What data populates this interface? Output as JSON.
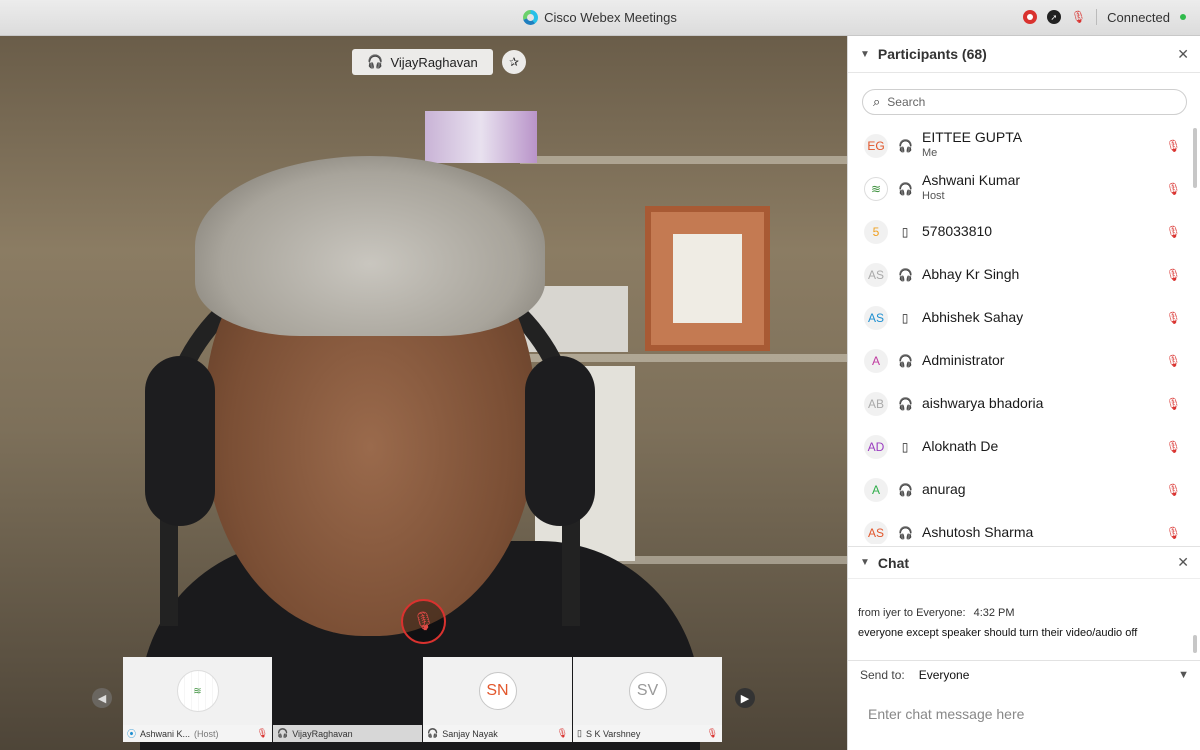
{
  "window": {
    "title": "Cisco Webex Meetings",
    "status": "Connected"
  },
  "video": {
    "active_speaker": "VijayRaghavan",
    "thumbnails": [
      {
        "name": "Ashwani K...",
        "role": "(Host)",
        "initials": ""
      },
      {
        "name": "VijayRaghavan",
        "role": "",
        "initials": ""
      },
      {
        "name": "Sanjay Nayak",
        "role": "",
        "initials": "SN"
      },
      {
        "name": "S K Varshney",
        "role": "",
        "initials": "SV"
      }
    ]
  },
  "participants": {
    "title": "Participants (68)",
    "search_placeholder": "Search",
    "items": [
      {
        "initials": "EG",
        "name": "EITTEE GUPTA",
        "sub": "Me",
        "device": "headset",
        "color": "#e2572c"
      },
      {
        "initials": "",
        "name": "Ashwani Kumar",
        "sub": "Host",
        "device": "headset",
        "color": "#3a8f3a"
      },
      {
        "initials": "5",
        "name": "578033810",
        "sub": "",
        "device": "phone",
        "color": "#f0a020"
      },
      {
        "initials": "AS",
        "name": "Abhay Kr Singh",
        "sub": "",
        "device": "headset",
        "color": "#aaaaaa"
      },
      {
        "initials": "AS",
        "name": "Abhishek Sahay",
        "sub": "",
        "device": "phone",
        "color": "#1e8fd1"
      },
      {
        "initials": "A",
        "name": "Administrator",
        "sub": "",
        "device": "headset",
        "color": "#c03aa0"
      },
      {
        "initials": "AB",
        "name": "aishwarya bhadoria",
        "sub": "",
        "device": "headset",
        "color": "#aaaaaa"
      },
      {
        "initials": "AD",
        "name": "Aloknath De",
        "sub": "",
        "device": "phone",
        "color": "#9a3cc0"
      },
      {
        "initials": "A",
        "name": "anurag",
        "sub": "",
        "device": "headset",
        "color": "#2fae4a"
      },
      {
        "initials": "AS",
        "name": "Ashutosh Sharma",
        "sub": "",
        "device": "headset",
        "color": "#e2572c"
      }
    ]
  },
  "chat": {
    "title": "Chat",
    "message": {
      "from": "from iyer to Everyone:",
      "time": "4:32  PM",
      "text": "everyone except speaker should turn their video/audio off"
    },
    "send_to_label": "Send to:",
    "send_to_value": "Everyone",
    "input_placeholder": "Enter chat message here"
  }
}
